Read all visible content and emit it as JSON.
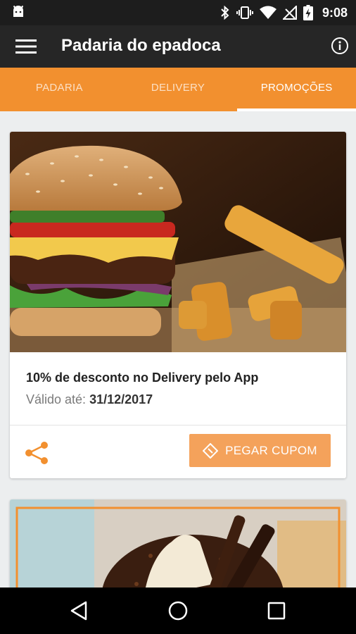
{
  "status_bar": {
    "time": "9:08"
  },
  "toolbar": {
    "title": "Padaria do epadoca"
  },
  "tabs": [
    {
      "label": "PADARIA",
      "active": false
    },
    {
      "label": "DELIVERY",
      "active": false
    },
    {
      "label": "PROMOÇÕES",
      "active": true
    }
  ],
  "promotions": [
    {
      "title": "10% de desconto no Delivery pelo App",
      "valid_label": "Válido até:",
      "valid_date": "31/12/2017",
      "button_label": "PEGAR CUPOM"
    }
  ],
  "colors": {
    "accent": "#f2902f",
    "button": "#f4a25b",
    "toolbar": "#262626"
  }
}
